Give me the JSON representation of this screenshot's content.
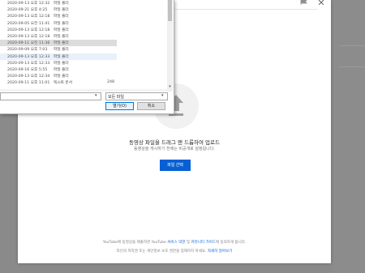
{
  "dialog": {
    "files": [
      {
        "date": "2020-09-13 오후 12:32",
        "type": "파일 폴더",
        "size": "",
        "state": ""
      },
      {
        "date": "2020-09-21 오후 4:25",
        "type": "파일 폴더",
        "size": "",
        "state": ""
      },
      {
        "date": "2020-09-13 오후 12:18",
        "type": "파일 폴더",
        "size": "",
        "state": ""
      },
      {
        "date": "2020-09-05 오전 11:41",
        "type": "파일 폴더",
        "size": "",
        "state": ""
      },
      {
        "date": "2020-09-13 오후 12:18",
        "type": "파일 폴더",
        "size": "",
        "state": ""
      },
      {
        "date": "2020-09-13 오후 12:18",
        "type": "파일 폴더",
        "size": "",
        "state": ""
      },
      {
        "date": "2020-09-11 오전 11:36",
        "type": "파일 폴더",
        "size": "",
        "state": "selected"
      },
      {
        "date": "2020-09-09 오후 7:03",
        "type": "파일 폴더",
        "size": "",
        "state": ""
      },
      {
        "date": "2020-09-13 오후 12:33",
        "type": "파일 폴더",
        "size": "",
        "state": "hover"
      },
      {
        "date": "2020-09-13 오후 12:33",
        "type": "파일 폴더",
        "size": "",
        "state": ""
      },
      {
        "date": "2020-09-16 오후 5:55",
        "type": "파일 폴더",
        "size": "",
        "state": ""
      },
      {
        "date": "2020-09-13 오후 12:34",
        "type": "파일 폴더",
        "size": "",
        "state": ""
      },
      {
        "date": "2020-09-11 오후 11:01",
        "type": "텍스트 문서",
        "size": "248",
        "state": ""
      }
    ],
    "file_type": "모든 파일",
    "open_label": "열기(O)",
    "cancel_label": "취소"
  },
  "upload": {
    "title": "동영상 파일을 드래그 앤 드롭하여 업로드",
    "subtitle": "동영상을 게시하기 전에는 비공개로 설정됩니다.",
    "select_button": "파일 선택"
  },
  "footer": {
    "line1_pre": "YouTube에 동영상을 제출하면 YouTube ",
    "tos_link": "서비스 약관",
    "and": " 및 ",
    "guidelines_link": "커뮤니티 가이드",
    "line1_post": "에 동의하게 됩니다.",
    "line2_pre": "타인의 저작권 또는 개인정보 보호 권한을 침해하지 마세요. ",
    "learn_more": "자세히 알아보기"
  },
  "colors": {
    "accent": "#065fd4",
    "selected_row": "#dcdcdc",
    "hover_row": "#e8f1fb"
  }
}
